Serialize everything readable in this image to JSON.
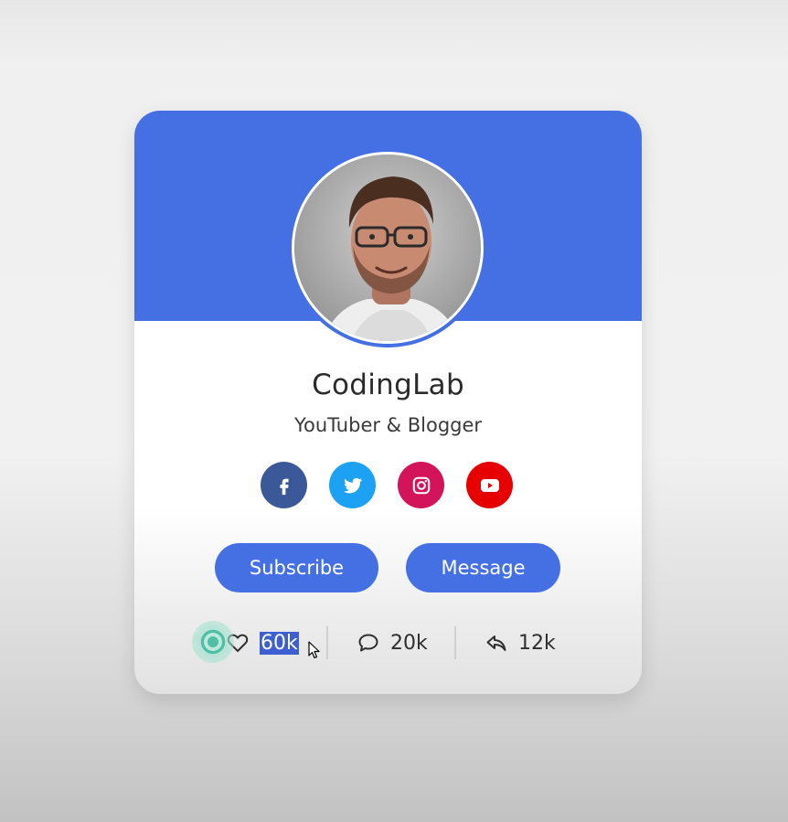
{
  "profile": {
    "name": "CodingLab",
    "role": "YouTuber & Blogger"
  },
  "socials": [
    {
      "icon": "facebook-icon",
      "color": "#3b5998"
    },
    {
      "icon": "twitter-icon",
      "color": "#1da1f2"
    },
    {
      "icon": "instagram-icon",
      "color": "#d4145a"
    },
    {
      "icon": "youtube-icon",
      "color": "#e60000"
    }
  ],
  "buttons": {
    "subscribe_label": "Subscribe",
    "message_label": "Message"
  },
  "stats": {
    "likes": "60k",
    "comments": "20k",
    "shares": "12k"
  },
  "colors": {
    "accent": "#4470e4",
    "selection": "#3d5fd1"
  }
}
